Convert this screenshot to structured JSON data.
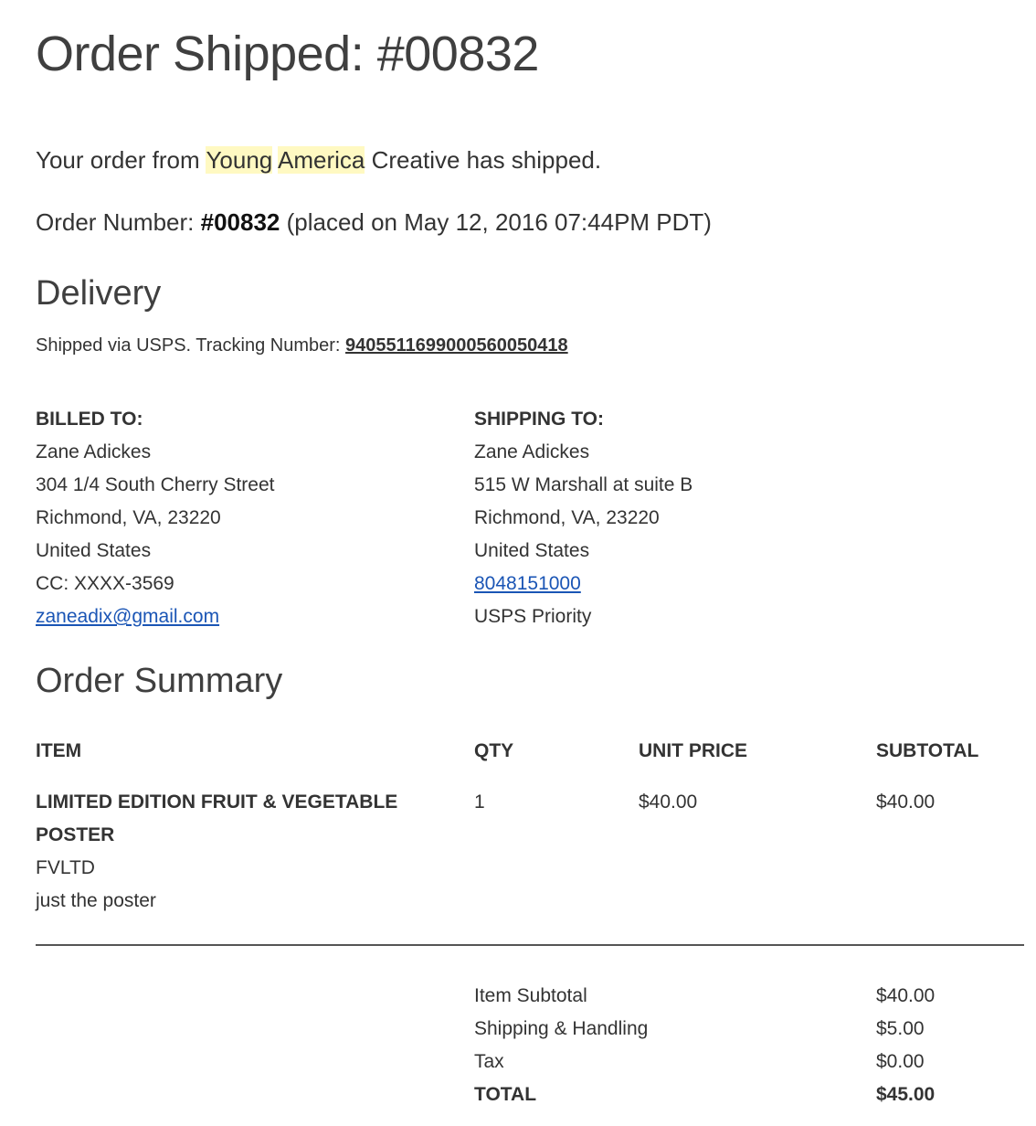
{
  "header": {
    "title": "Order Shipped: #00832"
  },
  "intro": {
    "prefix": "Your order from ",
    "store_word1": "Young",
    "store_space": " ",
    "store_word2": "America",
    "suffix": " Creative has shipped."
  },
  "order": {
    "label": "Order Number: ",
    "number": "#00832",
    "placed": " (placed on May 12, 2016 07:44PM PDT)"
  },
  "delivery": {
    "title": "Delivery",
    "shipped_text": "Shipped via USPS. Tracking Number: ",
    "tracking_number": "9405511699000560050418"
  },
  "billing": {
    "heading": "BILLED TO:",
    "name": "Zane Adickes",
    "street": "304 1/4 South Cherry Street",
    "city": "Richmond, VA, 23220",
    "country": "United States",
    "card": "CC: XXXX-3569",
    "email": "zaneadix@gmail.com"
  },
  "shipping": {
    "heading": "SHIPPING TO:",
    "name": "Zane Adickes",
    "street": "515 W Marshall at suite B",
    "city": "Richmond, VA, 23220",
    "country": "United States",
    "phone": "8048151000",
    "method": "USPS Priority"
  },
  "summary": {
    "title": "Order Summary",
    "columns": {
      "item": "ITEM",
      "qty": "QTY",
      "unit_price": "UNIT PRICE",
      "subtotal": "SUBTOTAL"
    },
    "items": [
      {
        "name": "LIMITED EDITION FRUIT & VEGETABLE POSTER",
        "sku": "FVLTD",
        "variant": "just the poster",
        "qty": "1",
        "unit_price": "$40.00",
        "subtotal": "$40.00"
      }
    ]
  },
  "totals": {
    "item_subtotal_label": "Item Subtotal",
    "item_subtotal": "$40.00",
    "shipping_label": "Shipping & Handling",
    "shipping": "$5.00",
    "tax_label": "Tax",
    "tax": "$0.00",
    "total_label": "TOTAL",
    "total": "$45.00"
  },
  "colors": {
    "highlight": "#fff9c2",
    "link": "#1a55b5",
    "text": "#333333"
  }
}
